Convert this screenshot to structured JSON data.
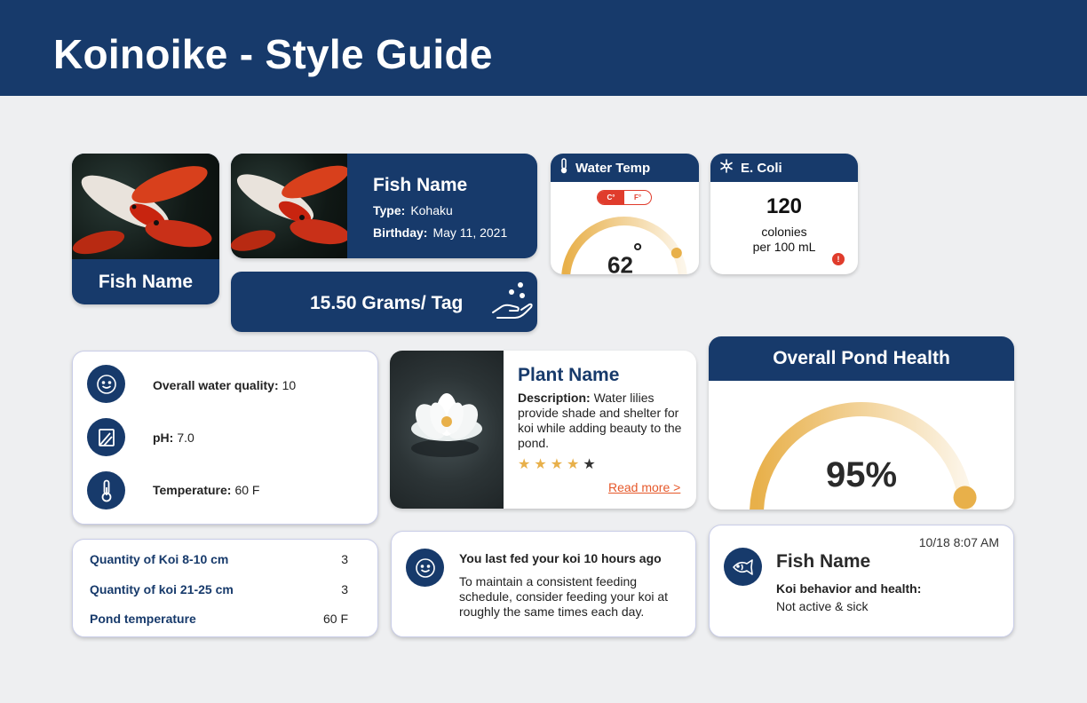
{
  "header": {
    "title": "Koinoike - Style Guide"
  },
  "fish_card": {
    "name": "Fish Name"
  },
  "fish_detail": {
    "name": "Fish Name",
    "type_label": "Type:",
    "type_value": "Kohaku",
    "birthday_label": "Birthday:",
    "birthday_value": "May 11, 2021"
  },
  "feeding": {
    "amount": "15.50 Grams/ Tag"
  },
  "water_temp": {
    "title": "Water Temp",
    "unit_c": "C°",
    "unit_f": "F°",
    "selected_unit": "C",
    "value": "62",
    "degree_symbol": "°",
    "gauge_fraction": 0.85
  },
  "ecoli": {
    "title": "E. Coli",
    "value": "120",
    "unit_line1": "colonies",
    "unit_line2": "per 100 mL",
    "alert": "!"
  },
  "water_quality": {
    "items": [
      {
        "label": "Overall water quality:",
        "value": "10",
        "icon": "smiley-icon"
      },
      {
        "label": "pH:",
        "value": "7.0",
        "icon": "ph-strip-icon"
      },
      {
        "label": "Temperature:",
        "value": "60 F",
        "icon": "thermometer-icon"
      }
    ]
  },
  "plant": {
    "name": "Plant Name",
    "description_label": "Description:",
    "description": "Water lilies provide shade and shelter for koi while adding beauty to the pond.",
    "rating": 4,
    "rating_max": 5,
    "read_more": "Read more >"
  },
  "pond_health": {
    "title": "Overall Pond Health",
    "value": "95%",
    "fraction": 0.95
  },
  "koi_quantity": {
    "rows": [
      {
        "label": "Quantity of Koi 8-10 cm",
        "value": "3"
      },
      {
        "label": "Quantity of koi 21-25 cm",
        "value": "3"
      },
      {
        "label": "Pond temperature",
        "value": "60 F"
      }
    ]
  },
  "feeding_notice": {
    "title": "You last fed your koi 10 hours ago",
    "body": "To maintain a consistent feeding schedule, consider feeding your koi at roughly the same times each day."
  },
  "behavior": {
    "timestamp": "10/18 8:07 AM",
    "name": "Fish Name",
    "label": "Koi behavior and health:",
    "value": "Not active & sick"
  },
  "colors": {
    "navy": "#173a6b",
    "accent_gold": "#e8b04a",
    "alert_red": "#e03c2c",
    "link_orange": "#e6582a",
    "background": "#eeeff1"
  }
}
